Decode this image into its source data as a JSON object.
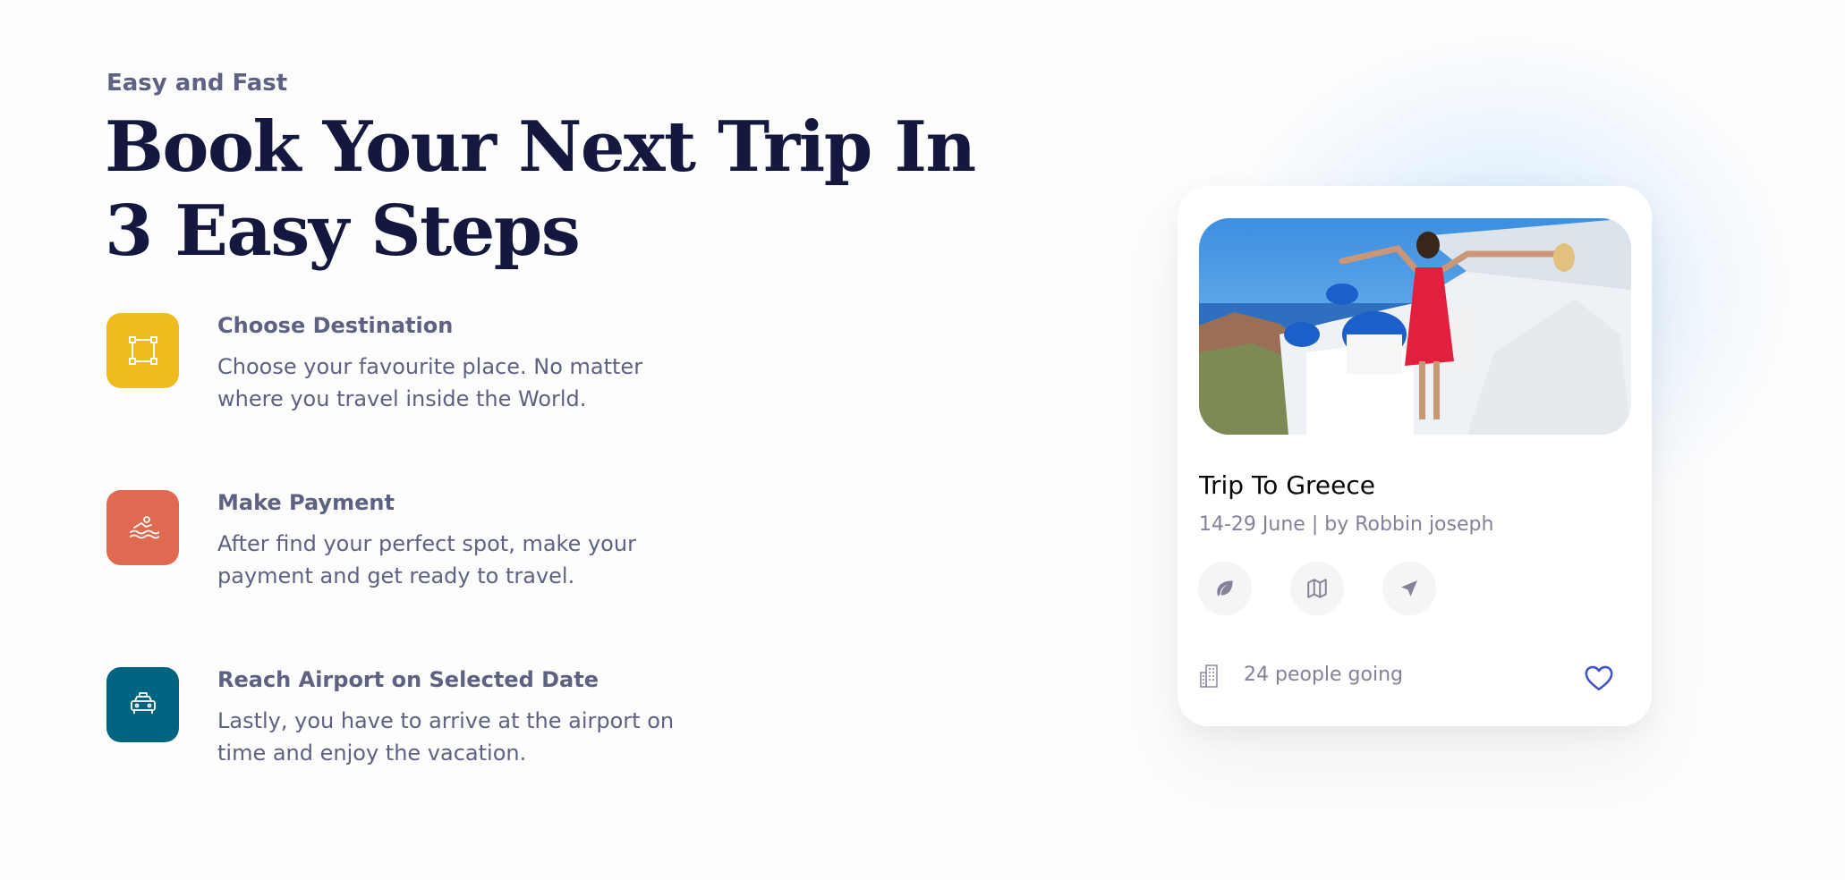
{
  "section": {
    "eyebrow": "Easy and Fast",
    "headline": "Book Your Next Trip In 3 Easy Steps"
  },
  "steps": [
    {
      "title": "Choose Destination",
      "description": "Choose your favourite place. No matter where you travel inside the World.",
      "icon": "selection-icon",
      "color": "#f0bb1f"
    },
    {
      "title": "Make Payment",
      "description": "After find your perfect spot, make your payment and get ready to travel.",
      "icon": "water-sport-icon",
      "color": "#f15a2b"
    },
    {
      "title": "Reach Airport on Selected Date",
      "description": "Lastly, you have to arrive at the airport on time and enjoy the vacation.",
      "icon": "taxi-icon",
      "color": "#006380"
    }
  ],
  "trip_card": {
    "title": "Trip To Greece",
    "meta": "14-29 June | by Robbin joseph",
    "actions": [
      "leaf-icon",
      "map-icon",
      "send-icon"
    ],
    "people_going": "24 people going",
    "favorite_icon": "heart-icon"
  },
  "colors": {
    "heading": "#14183e",
    "body_text": "#5e6282",
    "accent_heart": "#4152ca"
  }
}
